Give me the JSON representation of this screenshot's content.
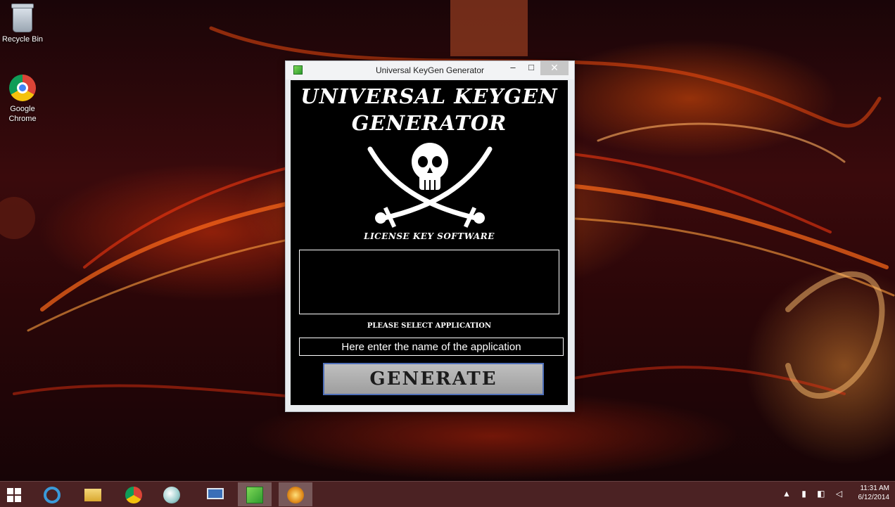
{
  "desktop": {
    "icons": [
      {
        "label": "Recycle Bin",
        "icon": "recycle-bin-icon"
      },
      {
        "label": "Google\nChrome",
        "icon": "chrome-icon"
      }
    ]
  },
  "window": {
    "title": "Universal KeyGen Generator",
    "controls": {
      "minimize": "–",
      "maximize": "□",
      "close": "✕"
    },
    "logo_line1": "UNIVERSAL KEYGEN",
    "logo_line2": "GENERATOR",
    "logo_subtitle": "LICENSE KEY SOFTWARE",
    "key_output": "",
    "select_label": "PLEASE SELECT APPLICATION",
    "app_input_value": "Here enter the name of the application",
    "generate_label": "GENERATE"
  },
  "taskbar": {
    "items": [
      "start-icon",
      "internet-explorer-icon",
      "file-explorer-icon",
      "chrome-icon",
      "paint-icon",
      "remote-desktop-icon",
      "keygen-app-icon",
      "running-app-icon"
    ],
    "clock_time": "11:31 AM",
    "clock_date": "6/12/2014"
  },
  "colors": {
    "window_bg": "#000000",
    "button_bg": "#bfbfbf",
    "button_border": "#4f6fb8"
  }
}
